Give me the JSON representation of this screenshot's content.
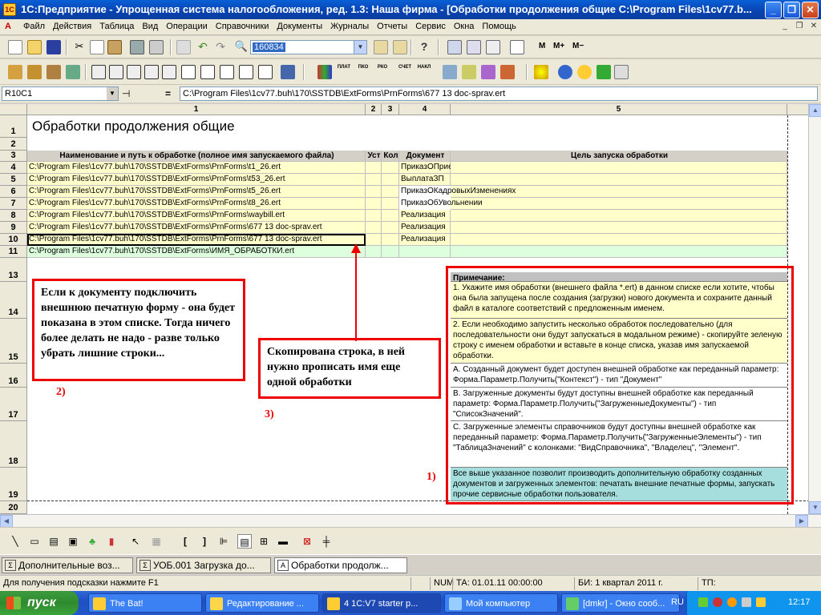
{
  "window": {
    "title": "1С:Предприятие - Упрощенная система налогообложения, ред. 1.3: Наша фирма - [Обработки продолжения общие C:\\Program Files\\1cv77.b...",
    "minimize": "_",
    "maximize": "❐",
    "close": "✕"
  },
  "menu": [
    "Файл",
    "Действия",
    "Таблица",
    "Вид",
    "Операции",
    "Справочники",
    "Документы",
    "Журналы",
    "Отчеты",
    "Сервис",
    "Окна",
    "Помощь"
  ],
  "mdi_controls": [
    "_",
    "❐",
    "✕"
  ],
  "toolbar1": {
    "search_value": "160834",
    "buttons": [
      "M",
      "M+",
      "M−"
    ]
  },
  "toolbar2": {
    "labels": [
      "ПЛАТ",
      "ПКО",
      "РКО",
      "СЧЕТ",
      "НАКЛ"
    ]
  },
  "formula": {
    "cell": "R10C1",
    "equals": "=",
    "value": "C:\\Program Files\\1cv77.buh\\170\\SSTDB\\ExtForms\\PrnForms\\677 13 doc-sprav.ert"
  },
  "columns": [
    "1",
    "2",
    "3",
    "4",
    "5"
  ],
  "rows": [
    "1",
    "2",
    "3",
    "4",
    "5",
    "6",
    "7",
    "8",
    "9",
    "10",
    "11",
    "13",
    "14",
    "15",
    "16",
    "17",
    "18",
    "19",
    "20"
  ],
  "sheet": {
    "title": "Обработки продолжения общие",
    "headers": [
      "Наименование и путь к обработке (полное имя запускаемого файла)",
      "Уст",
      "Кол",
      "Документ",
      "Цель запуска обработки"
    ],
    "data": [
      {
        "path": "C:\\Program Files\\1cv77.buh\\170\\SSTDB\\ExtForms\\PrnForms\\t1_26.ert",
        "doc": "ПриказОПриемеНаРаботу"
      },
      {
        "path": "C:\\Program Files\\1cv77.buh\\170\\SSTDB\\ExtForms\\PrnForms\\t53_26.ert",
        "doc": "ВыплатаЗП"
      },
      {
        "path": "C:\\Program Files\\1cv77.buh\\170\\SSTDB\\ExtForms\\PrnForms\\t5_26.ert",
        "doc": "ПриказОКадровыхИзменениях"
      },
      {
        "path": "C:\\Program Files\\1cv77.buh\\170\\SSTDB\\ExtForms\\PrnForms\\t8_26.ert",
        "doc": "ПриказОбУвольнении"
      },
      {
        "path": "C:\\Program Files\\1cv77.buh\\170\\SSTDB\\ExtForms\\PrnForms\\waybill.ert",
        "doc": "Реализация"
      },
      {
        "path": "C:\\Program Files\\1cv77.buh\\170\\SSTDB\\ExtForms\\PrnForms\\677 13 doc-sprav.ert",
        "doc": "Реализация"
      },
      {
        "path": "C:\\Program Files\\1cv77.buh\\170\\SSTDB\\ExtForms\\PrnForms\\677 13 doc-sprav.ert",
        "doc": "Реализация"
      },
      {
        "path": "C:\\Program Files\\1cv77.buh\\170\\SSTDB\\ExtForms\\ИМЯ_ОБРАБОТКИ.ert",
        "doc": ""
      }
    ]
  },
  "notes": {
    "header": "Примечание:",
    "n1": "1. Укажите имя обработки (внешнего файла *.ert) в данном списке если хотите, чтобы она была запущена после создания (загрузки) нового документа и сохраните данный файл в каталоге соответствий с предложенным именем.",
    "n2": "2. Если необходимо запустить несколько обработок последовательно (для последовательности они будут запускаться в модальном режиме) - скопируйте зеленую строку с именем обработки и вставьте в конце списка, указав имя запускаемой обработки.",
    "a": "A. Созданный документ будет доступен внешней обработке как переданный параметр: Форма.Параметр.Получить(\"Контекст\") - тип \"Документ\"",
    "b": "B. Загруженные документы будут доступны внешней обработке как переданный параметр: Форма.Параметр.Получить(\"ЗагруженныеДокументы\") - тип \"СписокЗначений\".",
    "c": "C. Загруженные элементы справочников будут доступны внешней обработке как переданный параметр: Форма.Параметр.Получить(\"ЗагруженныеЭлементы\") - тип \"ТаблицаЗначений\" с колонками: \"ВидСправочника\", \"Владелец\", \"Элемент\".",
    "summary": "Все выше указанное позволит производить дополнительную обработку созданных документов и загруженных элементов: печатать внешние печатные формы, запускать прочие сервисные обработки пользователя."
  },
  "annotations": {
    "box2": "Если к документу подключить внешнюю печатную форму - она будет показана в этом списке. Тогда ничего более делать не надо - разве только убрать лишние строки...",
    "num2": "2)",
    "box3": "Скопирована строка, в ней нужно прописать имя еще одной обработки",
    "num3": "3)",
    "num1": "1)"
  },
  "tabs": [
    "Дополнительные воз...",
    "УОБ.001 Загрузка до...",
    "Обработки продолж..."
  ],
  "status": {
    "hint": "Для получения подсказки нажмите F1",
    "num": "NUM",
    "ta": "ТА: 01.01.11  00:00:00",
    "bi": "БИ: 1 квартал 2011 г.",
    "tp": "ТП:"
  },
  "taskbar": {
    "start": "пуск",
    "tasks": [
      "The Bat!",
      "Редактирование ...",
      "4  1C:V7 starter p...",
      "Мой компьютер",
      "[dmkr] - Окно сооб..."
    ],
    "lang": "RU",
    "time": "12:17"
  },
  "colors": {
    "yellow": "#ffffcc",
    "green": "#ddffdd",
    "cyan": "#a6dede",
    "red": "#e00000",
    "title_blue": "#0842b0"
  }
}
